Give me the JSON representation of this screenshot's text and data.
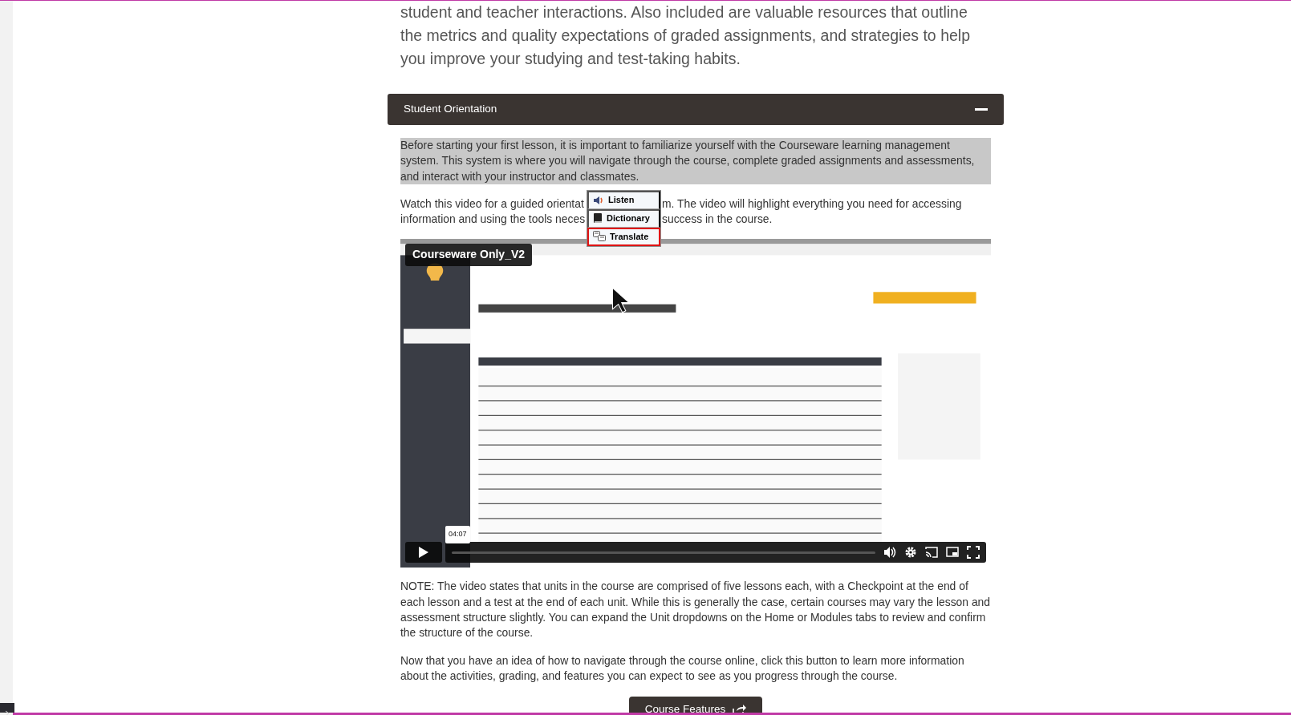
{
  "intro": "student and teacher interactions. Also included are valuable resources that outline the metrics and quality expectations of graded assignments, and strategies to help you improve your studying and test-taking habits.",
  "section": {
    "title": "Student Orientation",
    "expanded": true
  },
  "paragraphs": [
    {
      "text": "Before starting your first lesson, it is important to familiarize yourself with the Courseware learning management system. This system is where you will navigate through the course, complete graded assignments and assessments, and interact with your instructor and classmates.",
      "selected": true
    },
    {
      "lines": [
        [
          "Watch this video for a guided orientat",
          "m. The video will highlight everything you need for accessing"
        ],
        [
          "information and using the tools neces",
          "success in the course."
        ]
      ],
      "selected": false
    }
  ],
  "context_menu": [
    {
      "kind": "listen",
      "label": "Listen",
      "selected": false
    },
    {
      "kind": "dictionary",
      "label": "Dictionary",
      "selected": false
    },
    {
      "kind": "translate",
      "label": "Translate",
      "selected": true
    }
  ],
  "video": {
    "title": "Courseware Only_V2",
    "time_tooltip": "04:07"
  },
  "notes": [
    "NOTE: The video states that units in the course are comprised of five lessons each, with a Checkpoint at the end of each lesson and a test at the end of each unit. While this is generally the case, certain courses may vary the lesson and assessment structure slightly. You can expand the Unit dropdowns on the Home or Modules tabs to review and confirm the structure of the course.",
    "Now that you have an idea of how to navigate through the course online, click this button to learn more information about the activities, grading, and features you can expect to see as you progress through the course."
  ],
  "button": {
    "label": "Course Features"
  },
  "side_toggle": {
    "expanded": false
  }
}
